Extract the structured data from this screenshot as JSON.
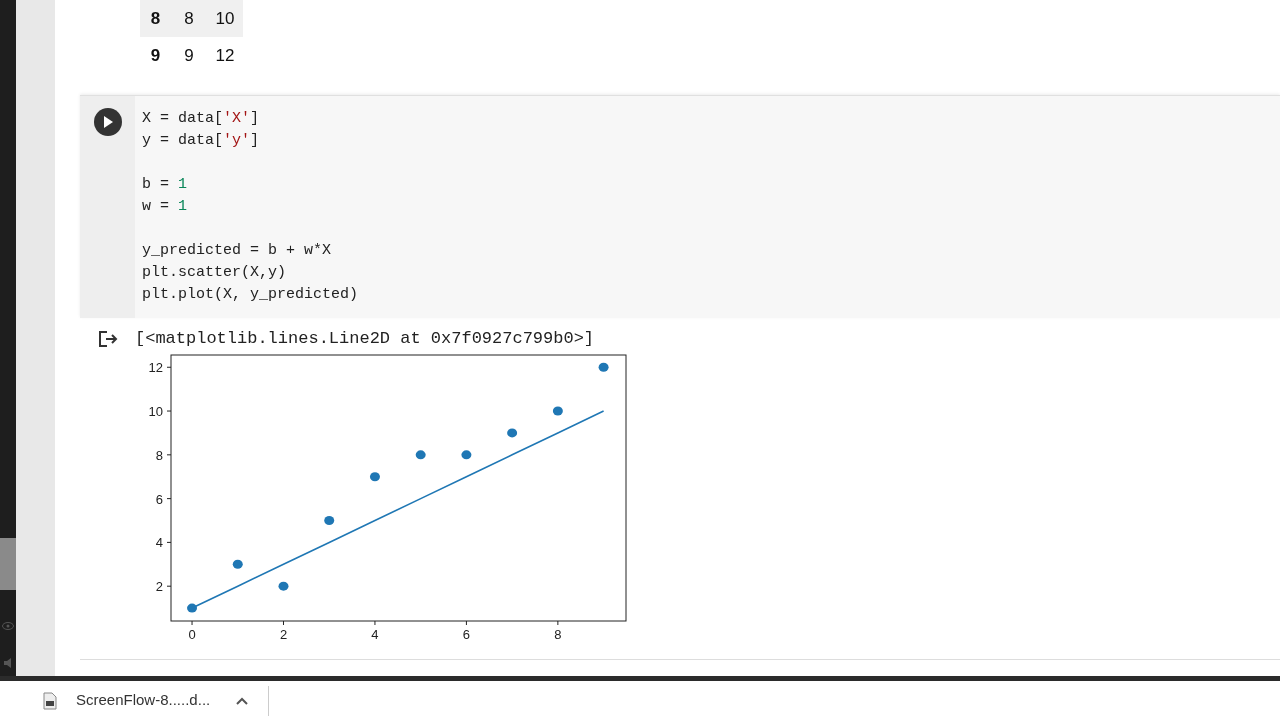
{
  "table": {
    "rows": [
      {
        "index": "8",
        "cells": [
          "8",
          "10"
        ],
        "shaded": true
      },
      {
        "index": "9",
        "cells": [
          "9",
          "12"
        ],
        "shaded": false
      }
    ]
  },
  "code_cell": {
    "lines": [
      {
        "kind": "code",
        "segments": [
          {
            "kind": "plain",
            "text": "X = data["
          },
          {
            "kind": "string",
            "text": "'X'"
          },
          {
            "kind": "plain",
            "text": "]"
          }
        ]
      },
      {
        "kind": "code",
        "segments": [
          {
            "kind": "plain",
            "text": "y = data["
          },
          {
            "kind": "string",
            "text": "'y'"
          },
          {
            "kind": "plain",
            "text": "]"
          }
        ]
      },
      {
        "kind": "blank"
      },
      {
        "kind": "code",
        "segments": [
          {
            "kind": "plain",
            "text": "b = "
          },
          {
            "kind": "number",
            "text": "1"
          }
        ]
      },
      {
        "kind": "code",
        "segments": [
          {
            "kind": "plain",
            "text": "w = "
          },
          {
            "kind": "number",
            "text": "1"
          }
        ]
      },
      {
        "kind": "blank"
      },
      {
        "kind": "code",
        "segments": [
          {
            "kind": "plain",
            "text": "y_predicted = b + w*X"
          }
        ]
      },
      {
        "kind": "code",
        "segments": [
          {
            "kind": "plain",
            "text": "plt.scatter(X,y)"
          }
        ]
      },
      {
        "kind": "code",
        "segments": [
          {
            "kind": "plain",
            "text": "plt.plot(X, y_predicted)"
          }
        ]
      }
    ]
  },
  "output": {
    "text": "[<matplotlib.lines.Line2D at 0x7f0927c799b0>]",
    "chart_data": {
      "type": "scatter",
      "x": [
        0,
        1,
        2,
        3,
        4,
        5,
        6,
        7,
        8,
        9
      ],
      "series": [
        {
          "type": "scatter",
          "color": "#1f77b4",
          "values": [
            1,
            3,
            2,
            5,
            7,
            8,
            8,
            9,
            10,
            12
          ]
        },
        {
          "type": "line",
          "color": "#1f77b4",
          "values": [
            1,
            2,
            3,
            4,
            5,
            6,
            7,
            8,
            9,
            10
          ]
        }
      ],
      "xlim": [
        -0.46,
        9.49
      ],
      "ylim": [
        0.41,
        12.56
      ],
      "xticks": [
        0,
        2,
        4,
        6,
        8
      ],
      "yticks": [
        2,
        4,
        6,
        8,
        10,
        12
      ]
    }
  },
  "download_bar": {
    "items": [
      {
        "filename": "ScreenFlow-8.....d..."
      }
    ]
  }
}
